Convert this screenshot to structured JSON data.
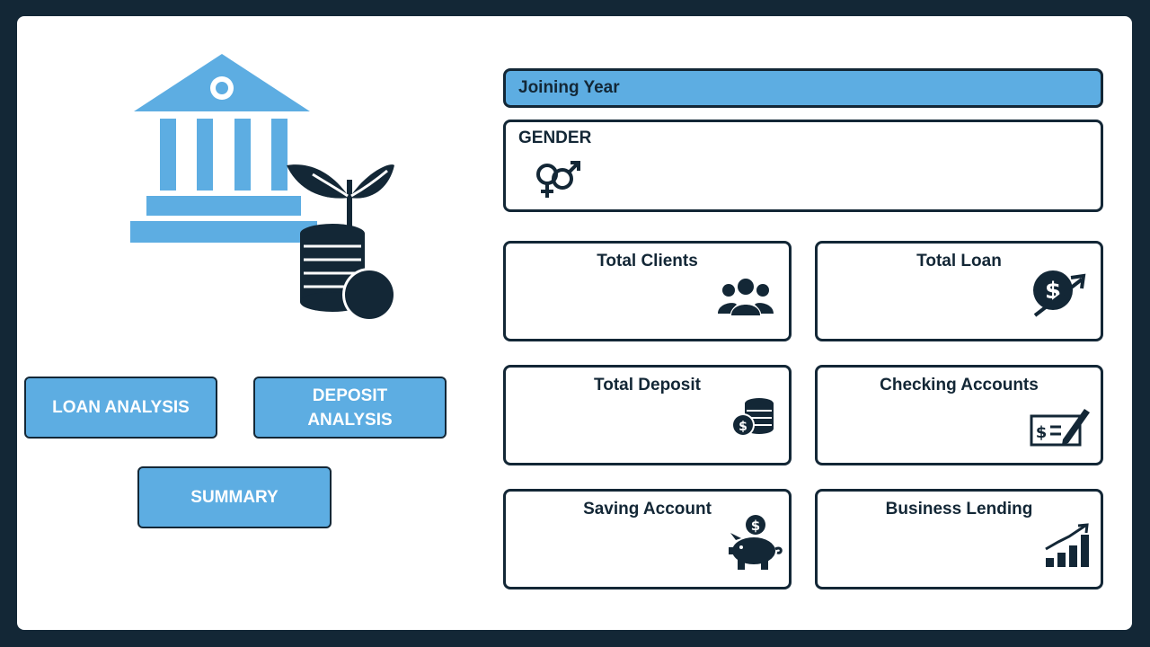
{
  "nav": {
    "loan_analysis": "LOAN ANALYSIS",
    "deposit_analysis_line1": "DEPOSIT",
    "deposit_analysis_line2": "ANALYSIS",
    "summary": "SUMMARY"
  },
  "slicers": {
    "joining_year": "Joining Year",
    "gender": "GENDER"
  },
  "cards": {
    "total_clients": "Total Clients",
    "total_loan": "Total Loan",
    "total_deposit": "Total Deposit",
    "checking_accounts": "Checking Accounts",
    "saving_account": "Saving Account",
    "business_lending": "Business Lending"
  },
  "icons": {
    "logo": "bank-plant-coins-icon",
    "gender": "gender-icon",
    "clients": "people-group-icon",
    "loan": "dollar-growth-icon",
    "deposit": "coins-stack-icon",
    "checking": "check-cheque-icon",
    "saving": "piggy-bank-icon",
    "lending": "bar-growth-icon"
  },
  "colors": {
    "background": "#132736",
    "panel": "#ffffff",
    "accent": "#5DADE2",
    "dark": "#132736"
  }
}
